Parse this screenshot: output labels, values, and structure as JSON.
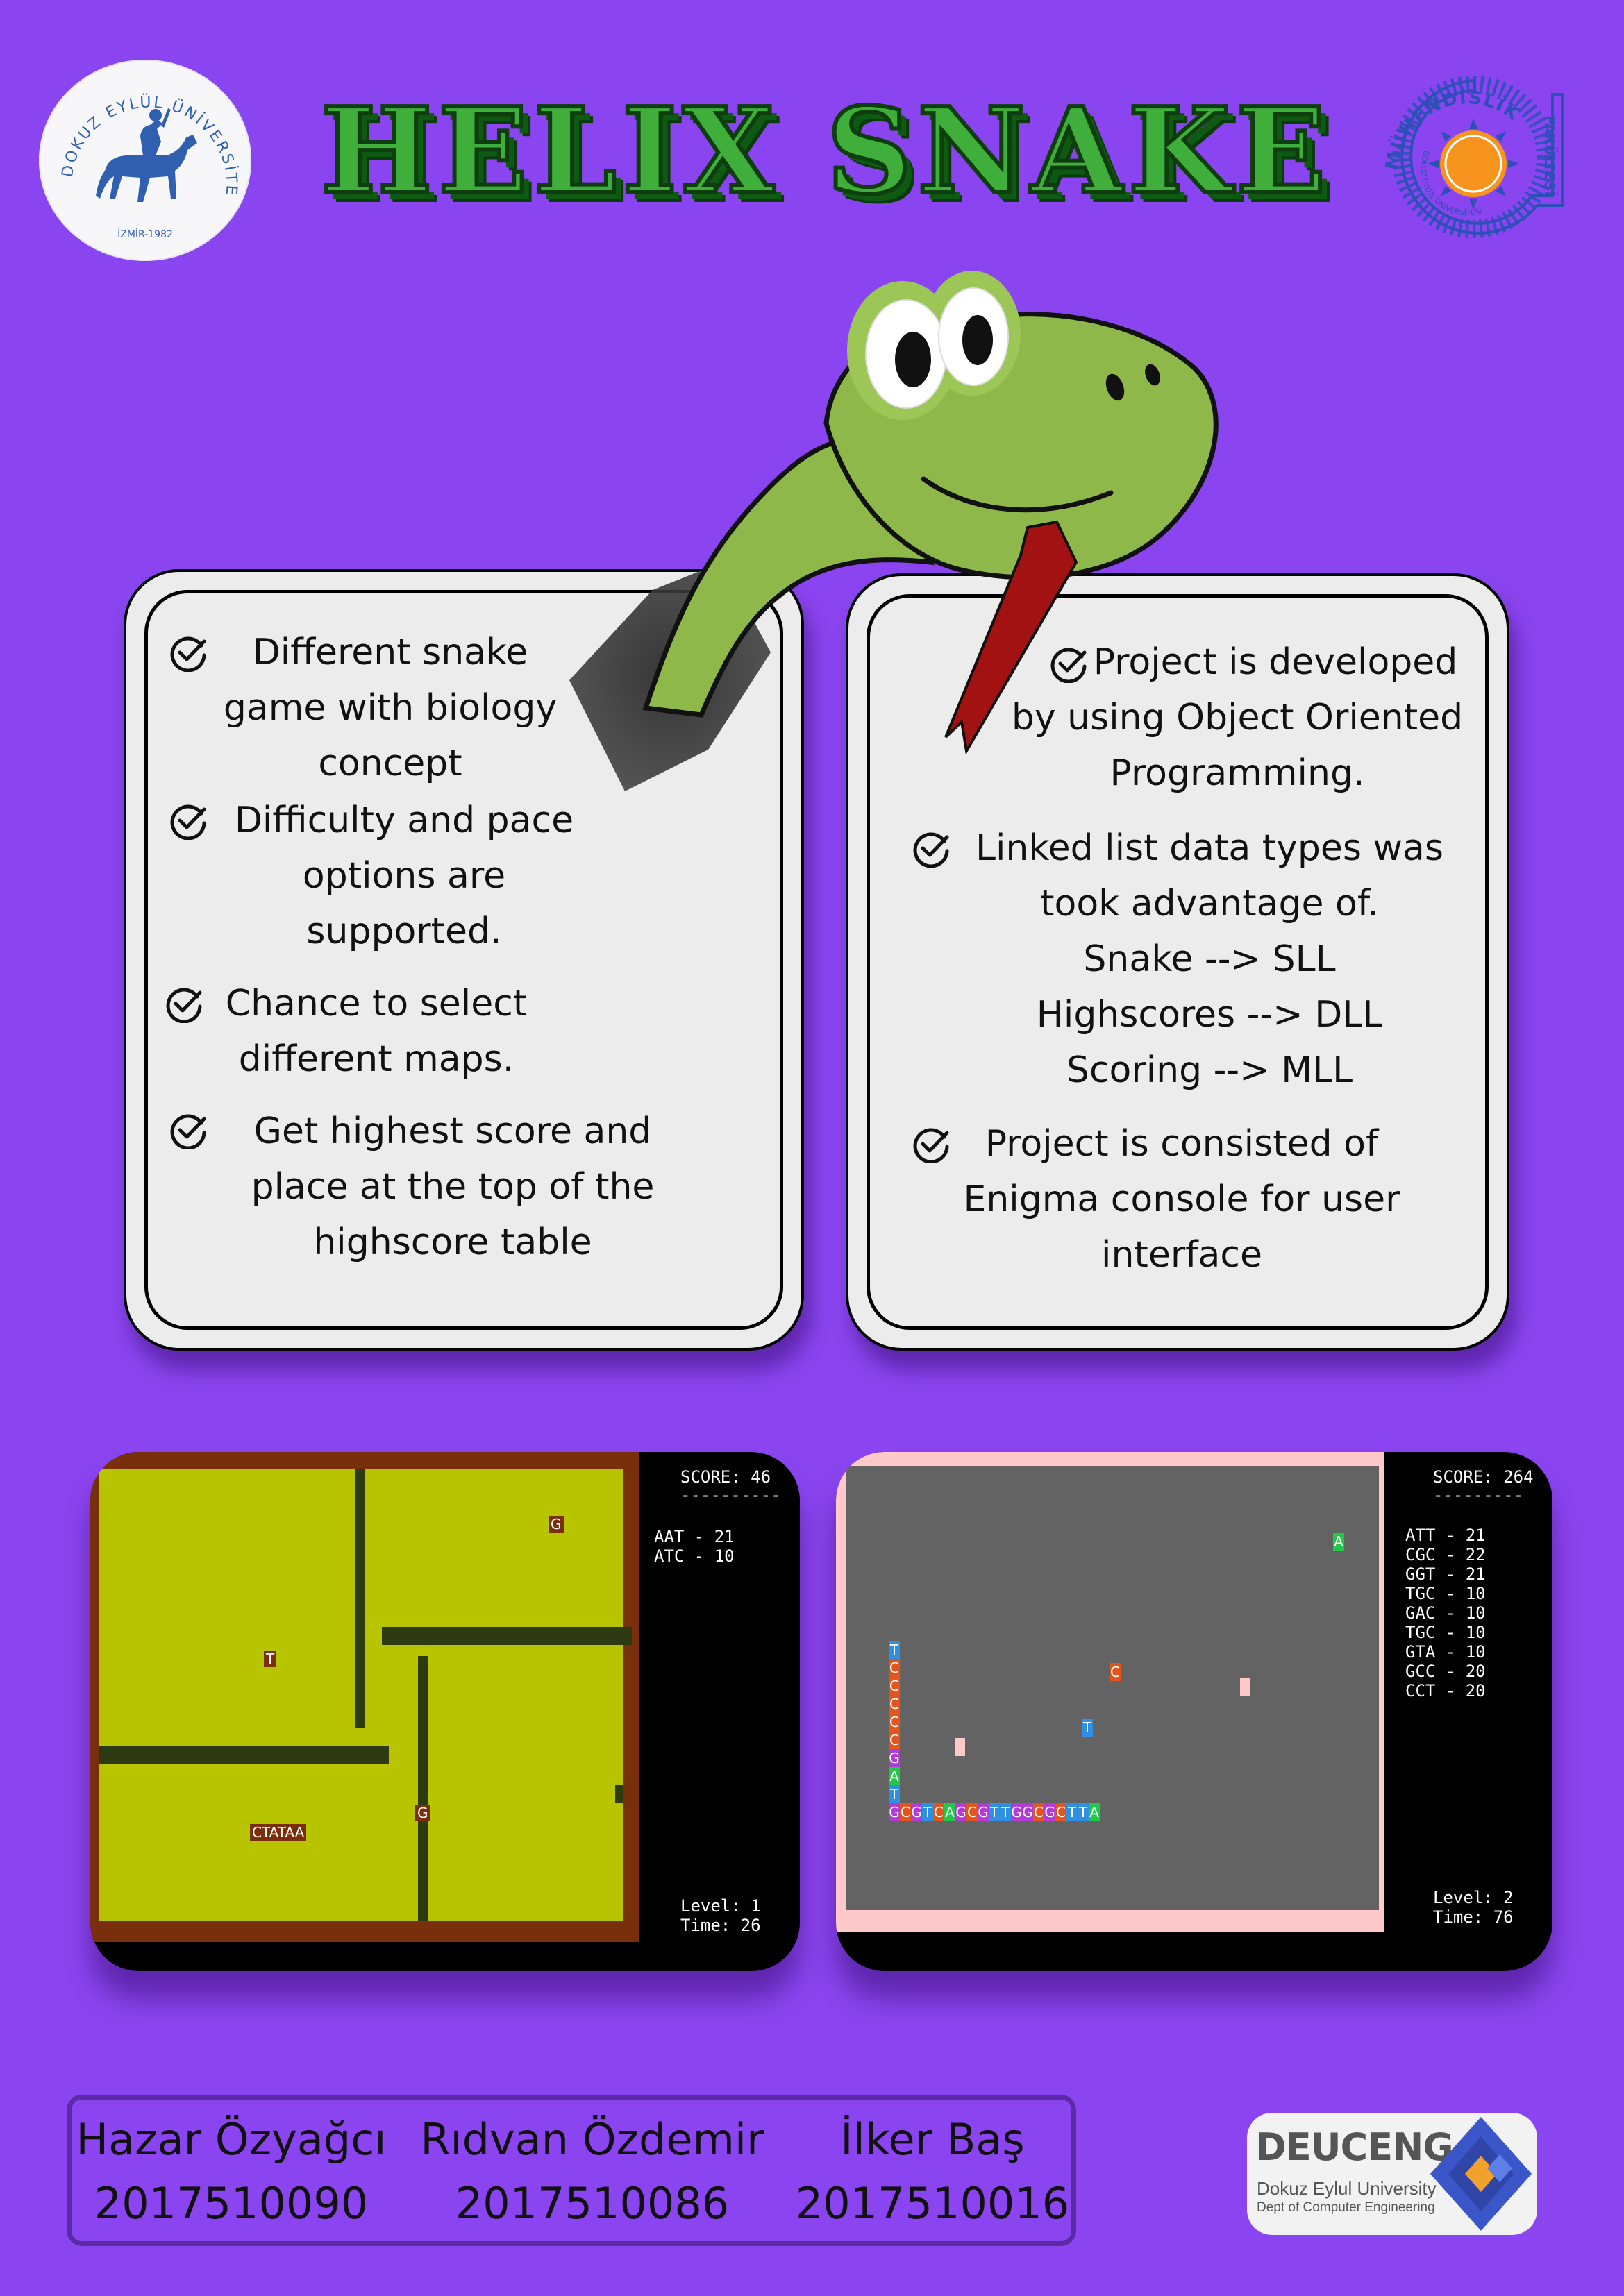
{
  "header": {
    "title": "HELIX SNAKE",
    "left_logo": {
      "ring_text": "DOKUZ EYLÜL ÜNİVERSİTESİ",
      "bottom_text": "İZMİR-1982",
      "color": "#2f5fae"
    },
    "right_logo": {
      "arc_text": "MÜHENDİSLİK",
      "side_text": "FAKÜLTESİ",
      "inner_text": "DOKUZ EYLÜL ÜNİVERSİTESİ",
      "color": "#2e4fb8",
      "sun_color": "#f7941d"
    }
  },
  "left_card": {
    "items": [
      {
        "lines": [
          "Different snake",
          "game with biology",
          "concept"
        ]
      },
      {
        "lines": [
          "Difficulty and pace",
          "options are",
          "supported."
        ]
      },
      {
        "lines": [
          "Chance to select",
          "different maps."
        ]
      },
      {
        "lines": [
          "Get highest score and",
          "place at the top of the",
          "highscore table"
        ]
      }
    ]
  },
  "right_card": {
    "items": [
      {
        "lines": [
          "Project is developed",
          "by using Object Oriented",
          "Programming."
        ]
      },
      {
        "lines": [
          "Linked list data types was",
          "took advantage of.",
          "Snake --> SLL",
          "Highscores --> DLL",
          "Scoring --> MLL"
        ]
      },
      {
        "lines": [
          "Project is consisted  of",
          "Enigma console for user",
          "interface"
        ]
      }
    ]
  },
  "game1": {
    "score_label": "SCORE: 46",
    "divider": "----------",
    "codons": [
      "AAT - 21",
      "ATC - 10"
    ],
    "level": "Level: 1",
    "time": "Time: 26",
    "tokens": {
      "g1": "G",
      "t1": "T",
      "g2": "G",
      "snake": "CTATAA"
    }
  },
  "game2": {
    "score_label": "SCORE: 264",
    "divider": "---------",
    "codons": [
      "ATT - 21",
      "CGC - 22",
      "GGT - 21",
      "TGC - 10",
      "GAC - 10",
      "TGC - 10",
      "GTA - 10",
      "GCC - 20",
      "CCT - 20"
    ],
    "level": "Level: 2",
    "time": "Time: 76",
    "tokens": {
      "a": "A",
      "c": "C",
      "t": "T"
    },
    "snake_vertical": [
      "T",
      "C",
      "C",
      "C",
      "C",
      "C",
      "G",
      "A",
      "T"
    ],
    "snake_horizontal": [
      "G",
      "C",
      "G",
      "T",
      "C",
      "A",
      "G",
      "C",
      "G",
      "T",
      "T",
      "G",
      "G",
      "C",
      "G",
      "C",
      "T",
      "T",
      "A"
    ]
  },
  "authors": [
    {
      "name": "Hazar Özyağcı",
      "id": "2017510090"
    },
    {
      "name": "Rıdvan Özdemir",
      "id": "2017510086"
    },
    {
      "name": "İlker Baş",
      "id": "2017510016"
    }
  ],
  "dept_logo": {
    "brand": "DEUCENG",
    "line1": "Dokuz Eylul University",
    "line2": "Dept of Computer Engineering"
  },
  "colors": {
    "background": "#8b45f0",
    "card": "#ececec",
    "title_fill": "#3fae3a",
    "title_shadow": "#0e5a12",
    "snake_green": "#8fb84a",
    "tongue_red": "#a31212"
  }
}
